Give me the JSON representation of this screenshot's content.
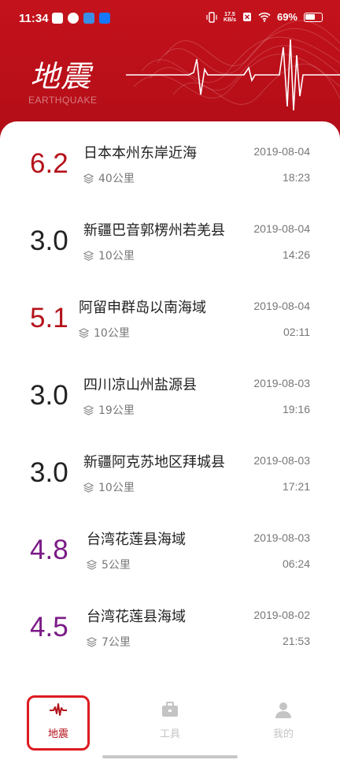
{
  "status_bar": {
    "time": "11:34",
    "net_speed_value": "17.5",
    "net_speed_unit": "KB/s",
    "battery": "69%"
  },
  "header": {
    "title": "地震",
    "subtitle": "EARTHQUAKE"
  },
  "quakes": [
    {
      "magnitude": "6.2",
      "place": "日本本州东岸近海",
      "depth": "40公里",
      "date": "2019-08-04",
      "time": "18:23",
      "color": "#b5121b"
    },
    {
      "magnitude": "3.0",
      "place": "新疆巴音郭楞州若羌县",
      "depth": "10公里",
      "date": "2019-08-04",
      "time": "14:26",
      "color": "#222222"
    },
    {
      "magnitude": "5.1",
      "place": "阿留申群岛以南海域",
      "depth": "10公里",
      "date": "2019-08-04",
      "time": "02:11",
      "color": "#b5121b"
    },
    {
      "magnitude": "3.0",
      "place": "四川凉山州盐源县",
      "depth": "19公里",
      "date": "2019-08-03",
      "time": "19:16",
      "color": "#222222"
    },
    {
      "magnitude": "3.0",
      "place": "新疆阿克苏地区拜城县",
      "depth": "10公里",
      "date": "2019-08-03",
      "time": "17:21",
      "color": "#222222"
    },
    {
      "magnitude": "4.8",
      "place": "台湾花莲县海域",
      "depth": "5公里",
      "date": "2019-08-03",
      "time": "06:24",
      "color": "#7a1a86"
    },
    {
      "magnitude": "4.5",
      "place": "台湾花莲县海域",
      "depth": "7公里",
      "date": "2019-08-02",
      "time": "21:53",
      "color": "#7a1a86"
    }
  ],
  "nav": {
    "items": [
      {
        "label": "地震",
        "icon": "seismograph-icon",
        "active": true
      },
      {
        "label": "工具",
        "icon": "toolbox-icon",
        "active": false
      },
      {
        "label": "我的",
        "icon": "person-icon",
        "active": false
      }
    ],
    "active_color": "#b5121b",
    "inactive_color": "#c4c4c4"
  }
}
